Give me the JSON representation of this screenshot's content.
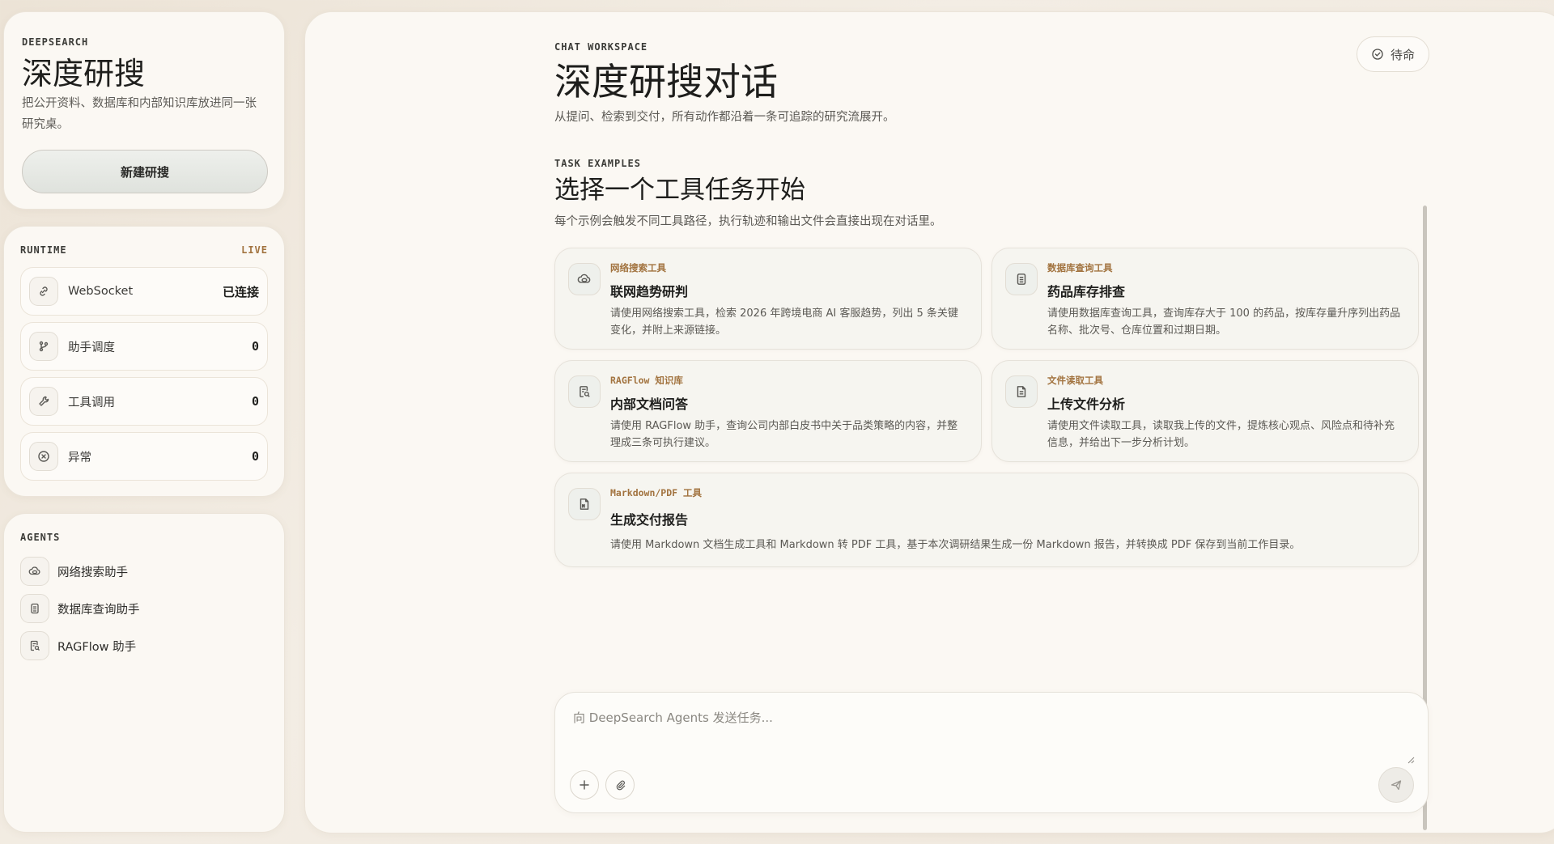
{
  "brand": {
    "eyebrow": "DEEPSEARCH",
    "title": "深度研搜",
    "description": "把公开资料、数据库和内部知识库放进同一张研究桌。",
    "new_button": "新建研搜"
  },
  "runtime": {
    "eyebrow": "RUNTIME",
    "live": "LIVE",
    "stats": [
      {
        "label": "WebSocket",
        "value": "已连接",
        "icon": "link-icon"
      },
      {
        "label": "助手调度",
        "value": "0",
        "icon": "branch-icon"
      },
      {
        "label": "工具调用",
        "value": "0",
        "icon": "wrench-icon"
      },
      {
        "label": "异常",
        "value": "0",
        "icon": "error-circle-icon"
      }
    ]
  },
  "agents": {
    "eyebrow": "AGENTS",
    "items": [
      {
        "label": "网络搜索助手",
        "icon": "cloud-globe-icon"
      },
      {
        "label": "数据库查询助手",
        "icon": "database-icon"
      },
      {
        "label": "RAGFlow 助手",
        "icon": "document-search-icon"
      }
    ]
  },
  "workspace": {
    "eyebrow": "CHAT WORKSPACE",
    "title": "深度研搜对话",
    "subtitle": "从提问、检索到交付，所有动作都沿着一条可追踪的研究流展开。",
    "status": "待命"
  },
  "tasks": {
    "eyebrow": "TASK EXAMPLES",
    "title": "选择一个工具任务开始",
    "subtitle": "每个示例会触发不同工具路径，执行轨迹和输出文件会直接出现在对话里。",
    "items": [
      {
        "tool": "网络搜索工具",
        "name": "联网趋势研判",
        "desc": "请使用网络搜索工具，检索 2026 年跨境电商 AI 客服趋势，列出 5 条关键变化，并附上来源链接。",
        "icon": "cloud-globe-icon"
      },
      {
        "tool": "数据库查询工具",
        "name": "药品库存排查",
        "desc": "请使用数据库查询工具，查询库存大于 100 的药品，按库存量升序列出药品名称、批次号、仓库位置和过期日期。",
        "icon": "database-icon"
      },
      {
        "tool": "RAGFlow 知识库",
        "name": "内部文档问答",
        "desc": "请使用 RAGFlow 助手，查询公司内部白皮书中关于品类策略的内容，并整理成三条可执行建议。",
        "icon": "document-search-icon"
      },
      {
        "tool": "文件读取工具",
        "name": "上传文件分析",
        "desc": "请使用文件读取工具，读取我上传的文件，提炼核心观点、风险点和待补充信息，并给出下一步分析计划。",
        "icon": "file-text-icon"
      },
      {
        "tool": "Markdown/PDF 工具",
        "name": "生成交付报告",
        "desc": "请使用 Markdown 文档生成工具和 Markdown 转 PDF 工具，基于本次调研结果生成一份 Markdown 报告，并转换成 PDF 保存到当前工作目录。",
        "icon": "markdown-file-icon"
      }
    ]
  },
  "composer": {
    "placeholder": "向 DeepSearch Agents 发送任务..."
  }
}
